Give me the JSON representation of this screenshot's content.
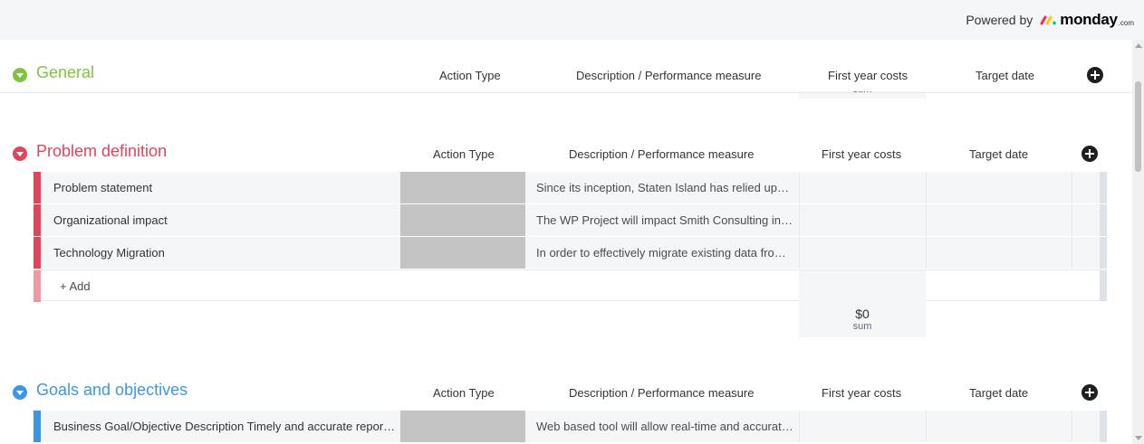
{
  "branding": {
    "powered_label": "Powered by",
    "logo_word": "monday",
    "logo_suffix": ".com"
  },
  "columns": {
    "action_type": "Action Type",
    "description": "Description / Performance measure",
    "first_year_costs": "First year costs",
    "target_date": "Target date"
  },
  "groups": [
    {
      "title": "General",
      "color": "#7ec53d",
      "partial_sum_label": "sum"
    },
    {
      "title": "Problem definition",
      "color": "#e2445c",
      "items": [
        {
          "name": "Problem statement",
          "description": "Since its inception, Staten Island has relied upon the use of…"
        },
        {
          "name": "Organizational impact",
          "description": "The WP Project will impact Smith Consulting in the following…"
        },
        {
          "name": "Technology Migration",
          "description": "In order to effectively migrate existing data from the current…"
        }
      ],
      "add_label": "+ Add",
      "sum_value": "$0",
      "sum_label": "sum"
    },
    {
      "title": "Goals and objectives",
      "color": "#3b97e3",
      "items": [
        {
          "name": "Business Goal/Objective Description Timely and accurate reporting of…",
          "description": "Web based tool will allow real-time and accurate reporting…"
        }
      ]
    }
  ],
  "icons": {
    "collapse": "chevron-down-icon",
    "add_column": "plus-circle-icon"
  }
}
